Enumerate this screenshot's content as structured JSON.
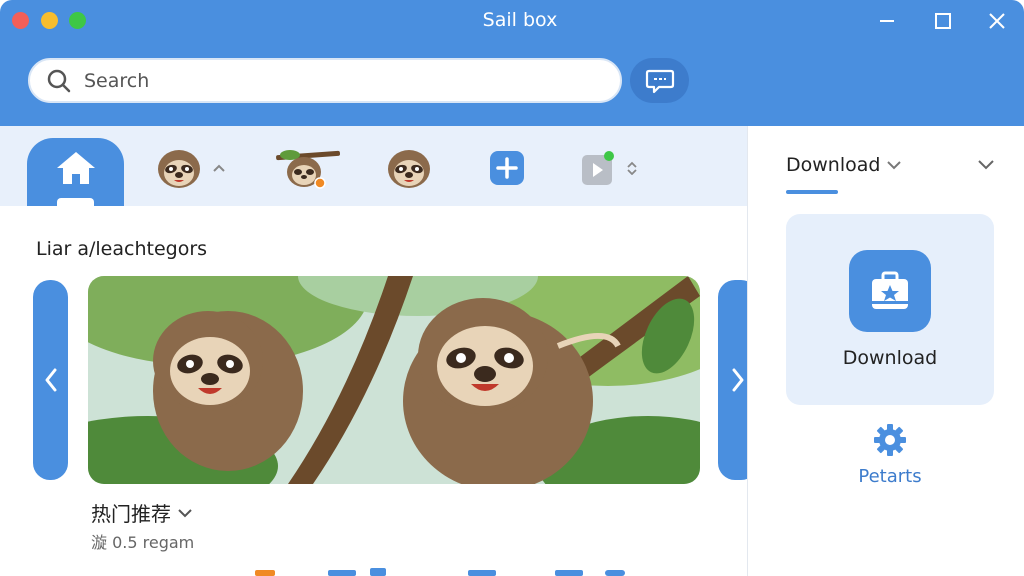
{
  "window": {
    "title": "Sail box"
  },
  "search": {
    "placeholder": "Search"
  },
  "main": {
    "section_title": "Liar a/leachtegors",
    "hot_label": "热门推荐",
    "sub_label": "漩 0.5 regam"
  },
  "right_panel": {
    "dropdown_label": "Download",
    "card_label": "Download",
    "parts_label": "Petarts"
  },
  "colors": {
    "accent": "#4a8fdf",
    "accent_dark": "#3d7ccc",
    "tab_bg": "#e8f0fb",
    "card_bg": "#e6effb"
  },
  "icons": [
    "search-icon",
    "chat-icon",
    "home-icon",
    "sloth-avatar-icon",
    "add-icon",
    "video-icon",
    "chevron-left-icon",
    "chevron-right-icon",
    "chevron-down-icon",
    "download-box-icon",
    "gear-icon"
  ]
}
